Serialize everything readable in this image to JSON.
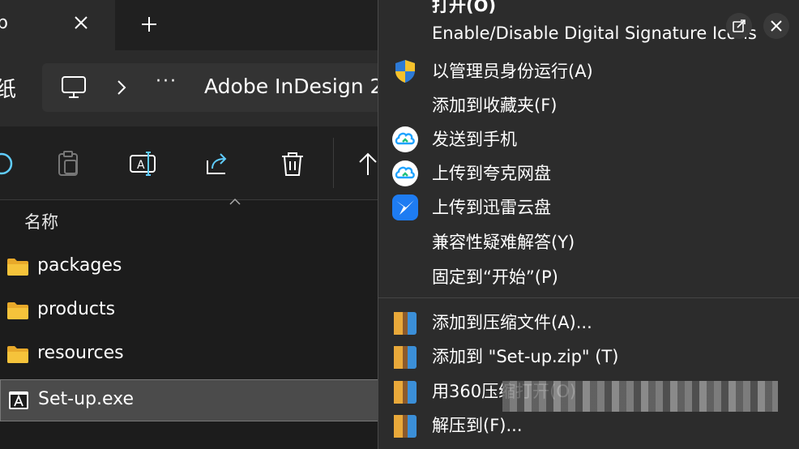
{
  "tabbar": {
    "tab_title": "p",
    "close_icon": "close-icon",
    "new_tab_icon": "plus-icon"
  },
  "address": {
    "back_partial": "纸",
    "pc_icon": "computer-icon",
    "overflow": "···",
    "path": "Adobe InDesign 2"
  },
  "toolbar": {
    "buttons": [
      "new-icon",
      "paste-icon",
      "rename-icon",
      "share-icon",
      "delete-icon",
      "up-icon"
    ]
  },
  "columns": {
    "name": "名称"
  },
  "files": [
    {
      "name": "packages",
      "type": "folder"
    },
    {
      "name": "products",
      "type": "folder"
    },
    {
      "name": "resources",
      "type": "folder"
    },
    {
      "name": "Set-up.exe",
      "type": "exe",
      "selected": true
    }
  ],
  "menu": {
    "items": [
      {
        "label": "打开(O)",
        "icon": ""
      },
      {
        "label": "Enable/Disable Digital Signature Icons",
        "icon": ""
      },
      {
        "label": "以管理员身份运行(A)",
        "icon": "uac-shield-icon"
      },
      {
        "label": "添加到收藏夹(F)",
        "icon": ""
      },
      {
        "label": "发送到手机",
        "icon": "cloud-icon"
      },
      {
        "label": "上传到夸克网盘",
        "icon": "cloud-icon"
      },
      {
        "label": "上传到迅雷云盘",
        "icon": "bird-icon"
      },
      {
        "label": "兼容性疑难解答(Y)",
        "icon": ""
      },
      {
        "label": "固定到“开始”(P)",
        "icon": ""
      },
      {
        "label": "添加到压缩文件(A)...",
        "icon": "archive-icon"
      },
      {
        "label": "添加到 \"Set-up.zip\" (T)",
        "icon": "archive-icon"
      },
      {
        "label": "用360压缩打开(O)",
        "icon": "archive-icon"
      },
      {
        "label": "解压到(F)...",
        "icon": "archive-icon"
      }
    ]
  },
  "window_controls": [
    "restore-icon",
    "close-icon"
  ],
  "colors": {
    "folder": "#f5c33b",
    "cloud": "#1fa3ff",
    "bird_bg": "#1e7cf2",
    "accent": "#60cdff"
  }
}
